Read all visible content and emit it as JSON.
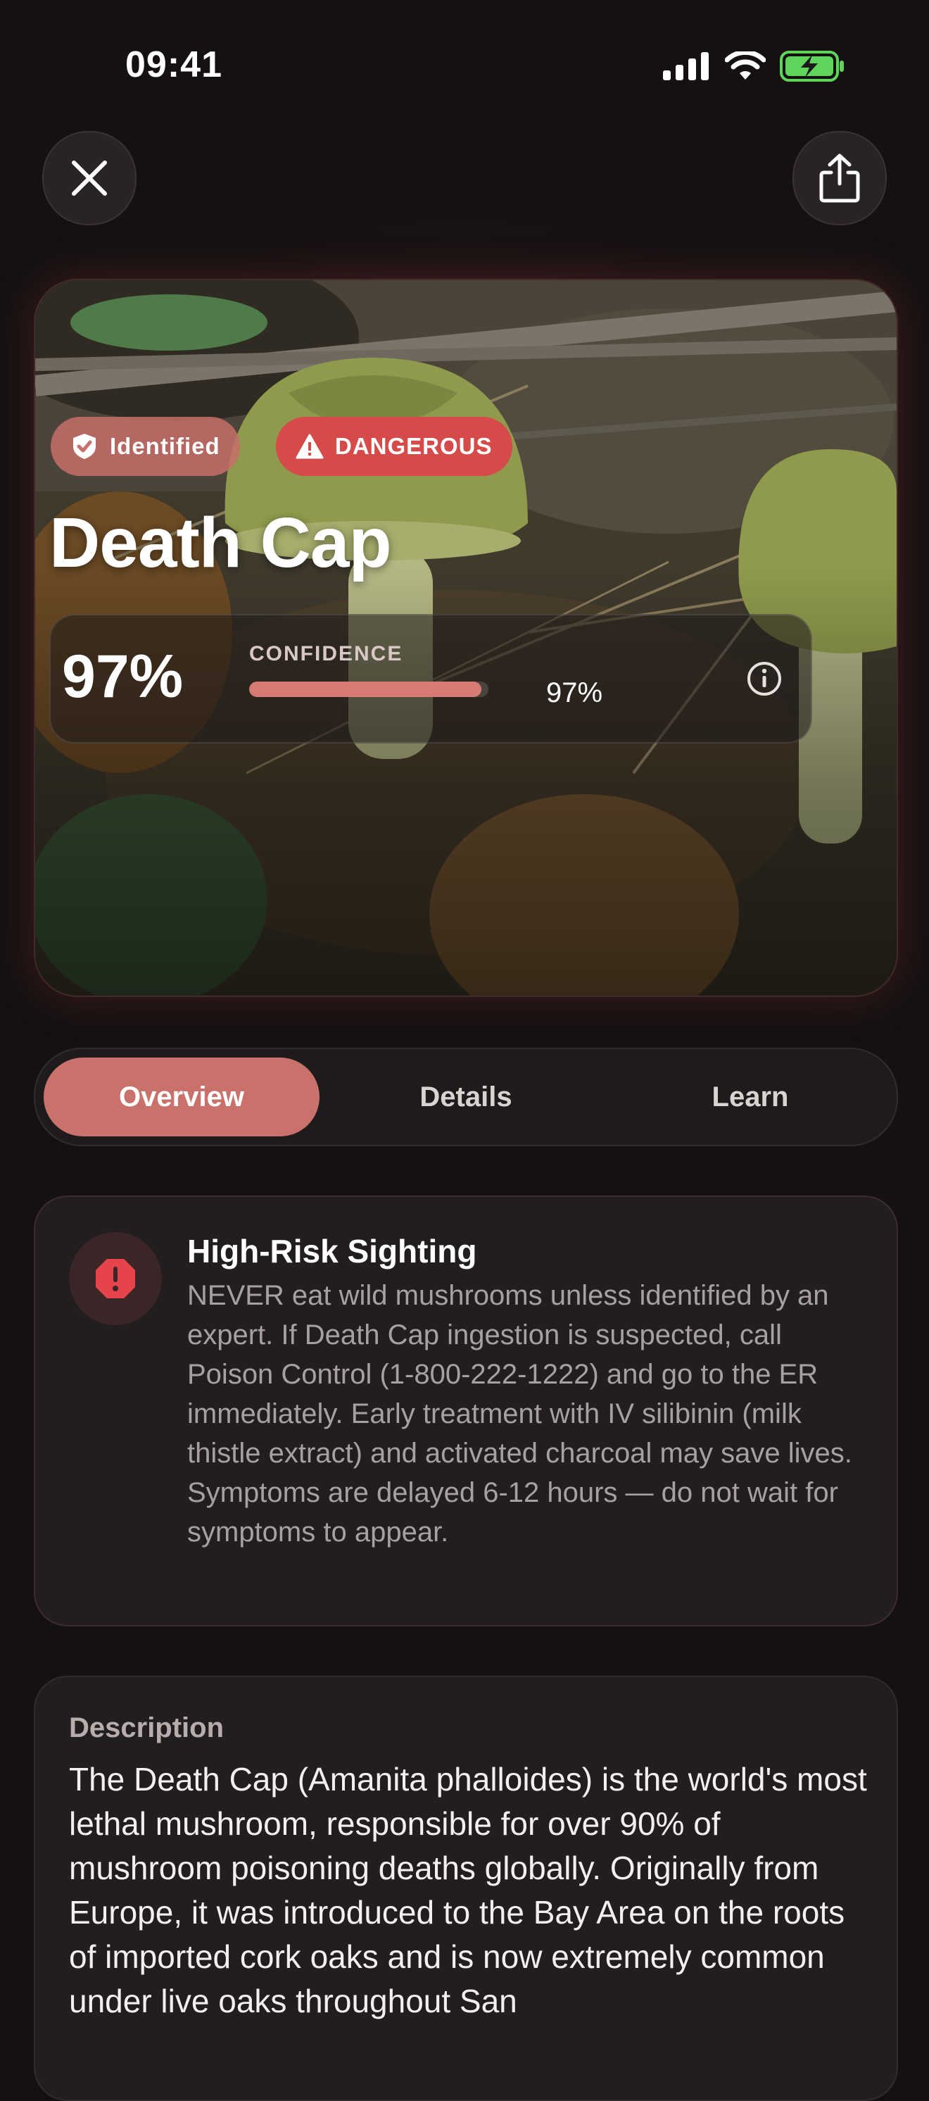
{
  "status_bar": {
    "time": "09:41"
  },
  "header": {
    "close_icon": "close-icon",
    "share_icon": "share-icon"
  },
  "hero": {
    "badges": [
      {
        "label": "Identified",
        "icon": "check-shield-icon"
      },
      {
        "label": "DANGEROUS",
        "icon": "warning-triangle-icon",
        "color": "#d64a4a"
      }
    ],
    "species_name": "Death Cap",
    "confidence": {
      "big_value": "97%",
      "label": "CONFIDENCE",
      "percent": 97,
      "small_value": "97%"
    }
  },
  "tabs": [
    {
      "label": "Overview",
      "active": true
    },
    {
      "label": "Details",
      "active": false
    },
    {
      "label": "Learn",
      "active": false
    }
  ],
  "alert": {
    "title": "High-Risk Sighting",
    "body": "NEVER eat wild mushrooms unless identified by an expert. If Death Cap ingestion is suspected, call Poison Control (1-800-222-1222) and go to the ER immediately. Early treatment with IV silibinin (milk thistle extract) and activated charcoal may save lives. Symptoms are delayed 6-12 hours — do not wait for symptoms to appear.",
    "icon": "alert-octagon-icon"
  },
  "description": {
    "title": "Description",
    "body": "The Death Cap (Amanita phalloides) is the world's most lethal mushroom, responsible for over 90% of mushroom poisoning deaths globally. Originally from Europe, it was introduced to the Bay Area on the roots of imported cork oaks and is now extremely common under live oaks throughout San"
  },
  "colors": {
    "accent": "#c9716b",
    "danger": "#d64a4a",
    "background": "#151112",
    "card": "#221e1f"
  }
}
